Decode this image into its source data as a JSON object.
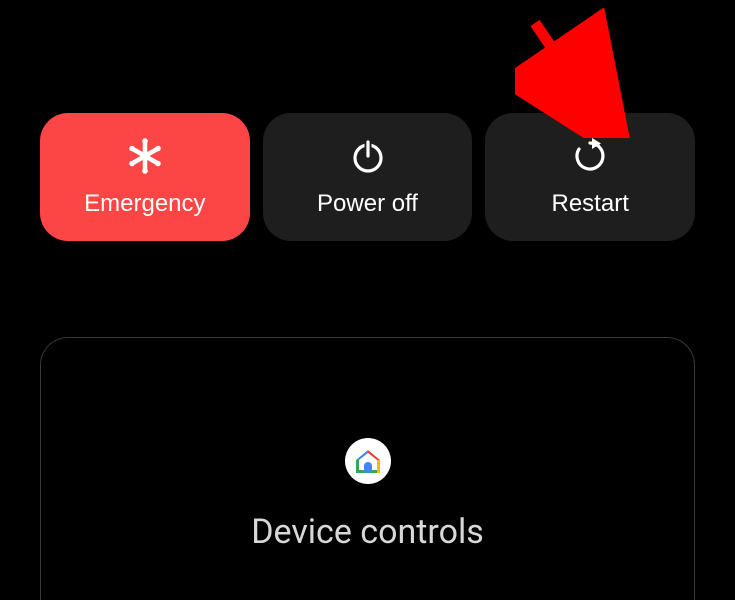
{
  "power_menu": {
    "emergency_label": "Emergency",
    "power_off_label": "Power off",
    "restart_label": "Restart"
  },
  "device_controls": {
    "title": "Device controls",
    "app_icon": "google-home"
  },
  "annotation": {
    "arrow_points_to": "restart-button"
  },
  "colors": {
    "emergency_bg": "#fc4545",
    "dark_btn_bg": "#1e1e1e",
    "panel_border": "#3a3a3a",
    "arrow": "#ff0000"
  }
}
